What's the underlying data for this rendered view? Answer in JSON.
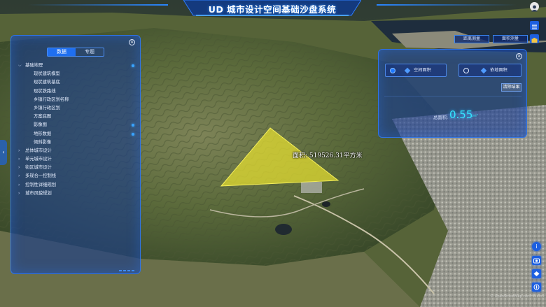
{
  "app": {
    "title": "UD 城市设计空间基础沙盘系统"
  },
  "left_panel": {
    "tabs": [
      {
        "label": "数据",
        "active": true
      },
      {
        "label": "专题",
        "active": false
      }
    ],
    "tree": [
      {
        "label": "基础地理",
        "level": 0,
        "expanded": true,
        "checked": true
      },
      {
        "label": "现状建筑模型",
        "level": 1,
        "checked": false
      },
      {
        "label": "现状建筑基底",
        "level": 1,
        "checked": false
      },
      {
        "label": "现状铁路线",
        "level": 1,
        "checked": false
      },
      {
        "label": "乡镇行政区划名称",
        "level": 1,
        "checked": false
      },
      {
        "label": "乡镇行政区划",
        "level": 1,
        "checked": false
      },
      {
        "label": "方案底图",
        "level": 1,
        "checked": false
      },
      {
        "label": "影像图",
        "level": 1,
        "checked": true
      },
      {
        "label": "地形数据",
        "level": 1,
        "checked": true
      },
      {
        "label": "倾斜影像",
        "level": 1,
        "checked": false
      },
      {
        "label": "总体城市设计",
        "level": 0,
        "expanded": false,
        "checked": false
      },
      {
        "label": "单元城市设计",
        "level": 0,
        "expanded": false,
        "checked": false
      },
      {
        "label": "街区城市设计",
        "level": 0,
        "expanded": false,
        "checked": false
      },
      {
        "label": "多规合一控制线",
        "level": 0,
        "expanded": false,
        "checked": false
      },
      {
        "label": "控制性详细规划",
        "level": 0,
        "expanded": false,
        "checked": false
      },
      {
        "label": "城市风貌规划",
        "level": 0,
        "expanded": false,
        "checked": false
      }
    ]
  },
  "measure_buttons": {
    "distance": "距离测量",
    "area": "面积测量"
  },
  "area_panel": {
    "options": [
      {
        "label": "空间面积",
        "selected": true
      },
      {
        "label": "依地面积",
        "selected": false
      }
    ],
    "clear_label": "清除结果",
    "total_label": "总面积:",
    "total_value": "0.55",
    "total_unit": "km²"
  },
  "map_label": {
    "text": "面积: 519526.31平方米"
  },
  "copyright": "© OpenStreetMap contributors",
  "colors": {
    "panel_border": "#2f74e8",
    "accent": "#35e7ff",
    "highlight_polygon": "#e8e030",
    "tool_button": "#1d5fe0"
  },
  "icons": {
    "top_right": [
      "user-avatar-icon",
      "list-icon",
      "toolbox-icon"
    ],
    "tools": [
      "info-icon",
      "camera-icon",
      "layers-icon",
      "compass-icon"
    ]
  }
}
